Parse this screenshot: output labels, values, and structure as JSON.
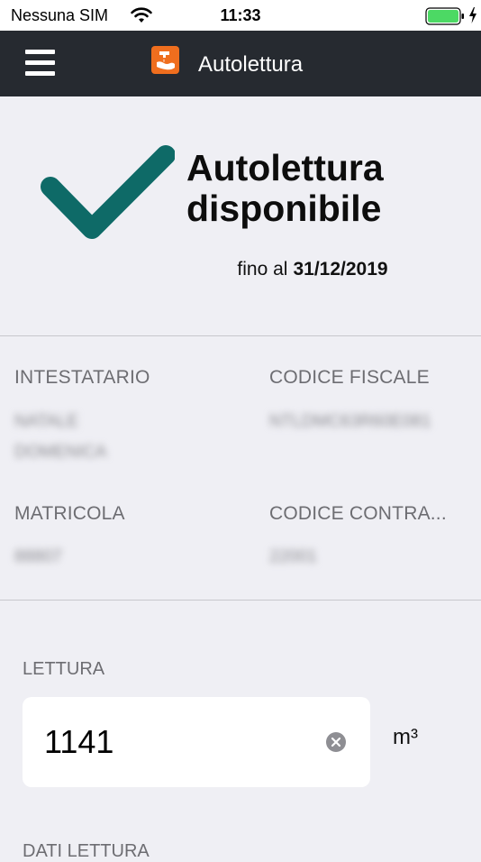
{
  "status_bar": {
    "carrier": "Nessuna SIM",
    "time": "11:33",
    "battery_color": "#4cd964"
  },
  "nav": {
    "title": "Autolettura",
    "background": "#262a30",
    "logo_color": "#ef6e1e"
  },
  "hero": {
    "title_line1": "Autolettura",
    "title_line2": "disponibile",
    "until_prefix": "fino al",
    "until_date": "31/12/2019",
    "check_color": "#0e6a67"
  },
  "info": {
    "intestatario_label": "INTESTATARIO",
    "intestatario_line1": "NATALE",
    "intestatario_line2": "DOMENICA",
    "codice_fiscale_label": "CODICE FISCALE",
    "codice_fiscale_value": "NTLDMC63R60E081",
    "matricola_label": "MATRICOLA",
    "matricola_value": "88807",
    "codice_contratto_label": "CODICE CONTRA...",
    "codice_contratto_value": "22001"
  },
  "lettura": {
    "label": "LETTURA",
    "value": "1141",
    "unit": "m³"
  },
  "dati_lettura": {
    "label": "DATI LETTURA"
  }
}
